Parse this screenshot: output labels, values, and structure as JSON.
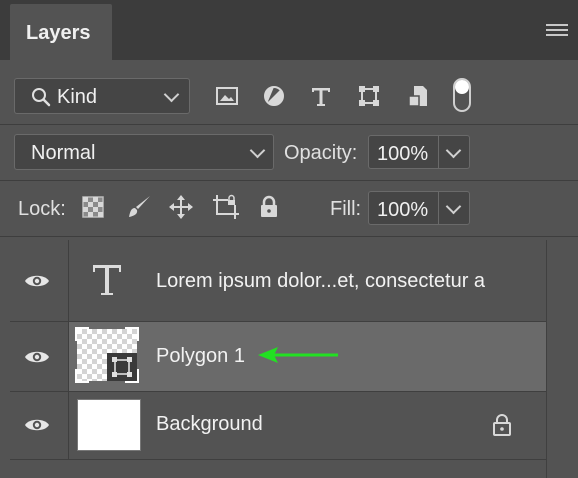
{
  "panel": {
    "tab_title": "Layers",
    "menu_icon": "panel-menu-icon"
  },
  "filter": {
    "kind_label": "Kind",
    "icons": [
      "search-icon",
      "pixel-layer-filter-icon",
      "adjustment-layer-filter-icon",
      "type-layer-filter-icon",
      "shape-layer-filter-icon",
      "smart-object-filter-icon",
      "filter-toggle-icon"
    ]
  },
  "blend": {
    "mode": "Normal",
    "opacity_label": "Opacity:",
    "opacity_value": "100%"
  },
  "lock": {
    "label": "Lock:",
    "icons": [
      "lock-transparent-pixels-icon",
      "lock-image-pixels-icon",
      "lock-position-icon",
      "lock-artboard-icon",
      "lock-all-icon"
    ],
    "fill_label": "Fill:",
    "fill_value": "100%"
  },
  "layers": [
    {
      "name": "Lorem ipsum dolor...et, consectetur a",
      "kind": "type",
      "visible": true,
      "selected": false
    },
    {
      "name": "Polygon 1",
      "kind": "shape",
      "visible": true,
      "selected": true
    },
    {
      "name": "Background",
      "kind": "pixel",
      "visible": true,
      "selected": false,
      "locked": true
    }
  ],
  "colors": {
    "panel_bg": "#535353",
    "selected_row": "#6a6a6a",
    "arrow": "#22e022"
  }
}
